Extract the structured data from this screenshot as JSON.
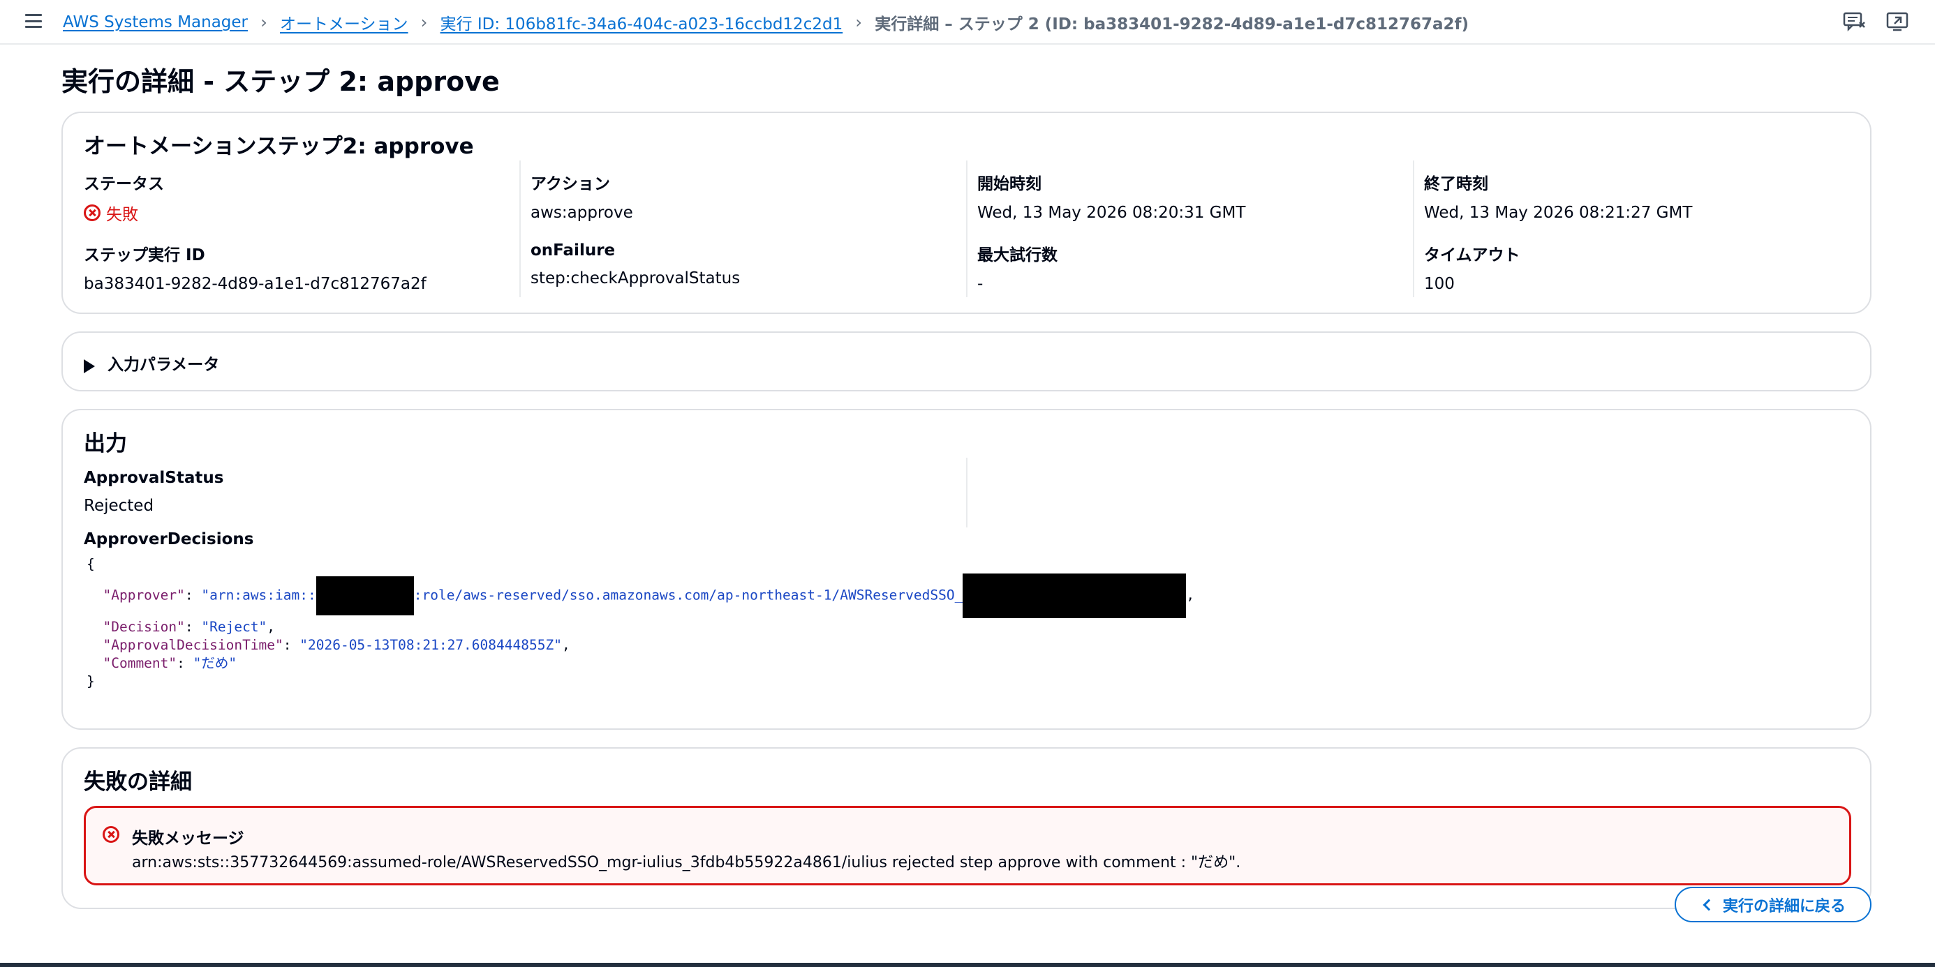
{
  "breadcrumbs": [
    {
      "label": "AWS Systems Manager"
    },
    {
      "label": "オートメーション"
    },
    {
      "label": "実行 ID: 106b81fc-34a6-404c-a023-16ccbd12c2d1"
    },
    {
      "label": "実行詳細 – ステップ 2 (ID: ba383401-9282-4d89-a1e1-d7c812767a2f)"
    }
  ],
  "page": {
    "title": "実行の詳細 - ステップ 2: approve"
  },
  "summary": {
    "title": "オートメーションステップ2: approve",
    "status_label": "ステータス",
    "status_value": "失敗",
    "action_label": "アクション",
    "action_value": "aws:approve",
    "start_label": "開始時刻",
    "start_value": "Wed, 13 May 2026 08:20:31 GMT",
    "end_label": "終了時刻",
    "end_value": "Wed, 13 May 2026 08:21:27 GMT",
    "step_id_label": "ステップ実行 ID",
    "step_id_value": "ba383401-9282-4d89-a1e1-d7c812767a2f",
    "onfailure_label": "onFailure",
    "onfailure_value": "step:checkApprovalStatus",
    "max_attempts_label": "最大試行数",
    "max_attempts_value": "-",
    "timeout_label": "タイムアウト",
    "timeout_value": "100"
  },
  "input_params": {
    "label": "入力パラメータ"
  },
  "output": {
    "title": "出力",
    "approval_status_label": "ApprovalStatus",
    "approval_status_value": "Rejected",
    "approver_decisions_label": "ApproverDecisions",
    "json": {
      "open": "{",
      "close": "}",
      "approver_key": "\"Approver\"",
      "approver_val_1": "\"arn:aws:iam::",
      "approver_val_2": ":role/aws-reserved/sso.amazonaws.com/ap-northeast-1/AWSReservedSSO_",
      "decision_key": "\"Decision\"",
      "decision_val": "\"Reject\"",
      "time_key": "\"ApprovalDecisionTime\"",
      "time_val": "\"2026-05-13T08:21:27.608444855Z\"",
      "comment_key": "\"Comment\"",
      "comment_val": "\"だめ\""
    }
  },
  "failure": {
    "title": "失敗の詳細",
    "message_title": "失敗メッセージ",
    "message_text": "arn:aws:sts::357732644569:assumed-role/AWSReservedSSO_mgr-iulius_3fdb4b55922a4861/iulius rejected step approve with comment : \"だめ\"."
  },
  "back_button": {
    "label": "実行の詳細に戻る"
  },
  "icons": {
    "menu": "hamburger-menu-icon",
    "feedback": "feedback-icon",
    "preferences": "display-preferences-icon",
    "status": "status-error-icon",
    "expand": "caret-right-icon",
    "back": "chevron-left-icon"
  },
  "colors": {
    "link": "#0972d3",
    "error": "#d91515",
    "text": "#000716"
  }
}
